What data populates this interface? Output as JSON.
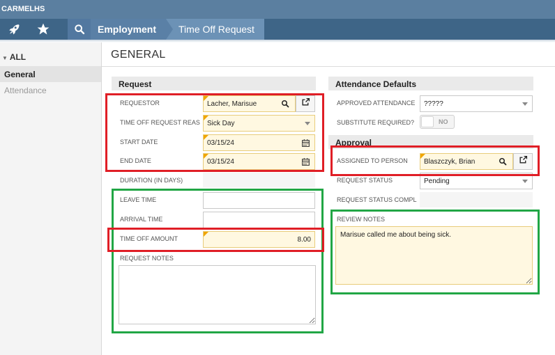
{
  "app": {
    "brand": "CARMELHS"
  },
  "nav": {
    "icons": [
      "rocket-icon",
      "star-icon",
      "search-icon"
    ],
    "breadcrumb": [
      "Employment",
      "Time Off Request"
    ]
  },
  "sidebar": {
    "all_label": "ALL",
    "items": [
      {
        "label": "General",
        "active": true
      },
      {
        "label": "Attendance",
        "active": false
      }
    ]
  },
  "page": {
    "title": "GENERAL"
  },
  "request": {
    "header": "Request",
    "requestor_label": "REQUESTOR",
    "requestor_value": "Lacher, Marisue",
    "reason_label": "TIME OFF REQUEST REAS...",
    "reason_value": "Sick Day",
    "start_label": "START DATE",
    "start_value": "03/15/24",
    "end_label": "END DATE",
    "end_value": "03/15/24",
    "duration_label": "DURATION (IN DAYS)",
    "leave_label": "LEAVE TIME",
    "leave_value": "",
    "arrival_label": "ARRIVAL TIME",
    "arrival_value": "",
    "amount_label": "TIME OFF AMOUNT",
    "amount_value": "8.00",
    "notes_label": "REQUEST NOTES",
    "notes_value": ""
  },
  "attendance": {
    "header": "Attendance Defaults",
    "approved_label": "APPROVED ATTENDANCE ...",
    "approved_value": "?????",
    "substitute_label": "SUBSTITUTE REQUIRED?",
    "substitute_value": "NO"
  },
  "approval": {
    "header": "Approval",
    "assigned_label": "ASSIGNED TO PERSON",
    "assigned_value": "Blaszczyk, Brian",
    "status_label": "REQUEST STATUS",
    "status_value": "Pending",
    "status_comp_label": "REQUEST STATUS COMPL...",
    "review_label": "REVIEW NOTES",
    "review_value": "Marisue called me about being sick."
  },
  "colors": {
    "header_bg": "#5b7fa0",
    "nav_bg": "#3e6587",
    "required_bg": "#fff8e1",
    "required_flag": "#f0a500",
    "annotation_red": "#e01e26",
    "annotation_green": "#21a645"
  }
}
